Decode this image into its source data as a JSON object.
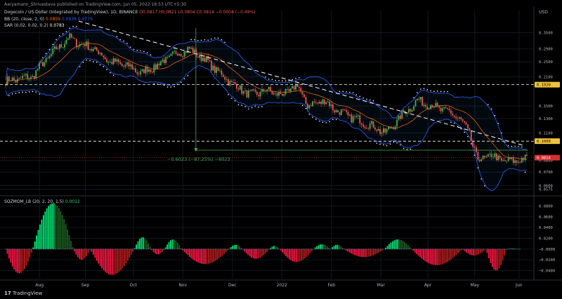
{
  "header": {
    "publisher": "Aaryamann_Shrivastava published on TradingView.com, Jun 05, 2022 18:53 UTC+5:30",
    "symbol": "Dogecoin / US Dollar (Integrated by TradingView), 1D, BINANCE",
    "ohlc": {
      "o": "O0.0817",
      "h": "H0.0821",
      "l": "L0.0804",
      "c": "C0.0814",
      "change": "−0.0004 (−0.49%)"
    },
    "currency": "USD"
  },
  "indicators": {
    "bb": {
      "label": "BB (20, close, 2, 0)",
      "v1": "0.0859",
      "v2": "0.0939",
      "v3": "0.0779"
    },
    "sar": {
      "label": "SAR (0.02, 0.02, 0.2)",
      "v1": "0.0783"
    },
    "sqz": {
      "label": "SQZMOM_LB (20, 2, 20, 1.5)",
      "v1": "0.0012"
    }
  },
  "measure_label": "−0.6023 (−87.25%) −6023",
  "logo": "TradingView",
  "colors": {
    "up": "#26a69a",
    "up_candle": "#4caf50",
    "down": "#ef5350",
    "bb_band": "#2962ff",
    "bb_basis": "#ff6d00",
    "sar": "#ffffff",
    "mom_up_strong": "#00e676",
    "mom_up_weak": "#1b5e20",
    "mom_down_strong": "#ff1744",
    "mom_down_weak": "#b71c1c",
    "measure": "#4caf50",
    "price_tag": "#d32f2f",
    "yellow_tag": "#f0c23a"
  },
  "chart_data": [
    {
      "type": "line",
      "title": "Dogecoin / US Dollar",
      "subtitle": "1D, BINANCE",
      "y_scale": "log",
      "x_ticks": [
        "Aug",
        "Sep",
        "Oct",
        "Nov",
        "Dec",
        "2022",
        "Feb",
        "Mar",
        "Apr",
        "May",
        "Jun"
      ],
      "y_ticks": [
        "0.3500",
        "0.2900",
        "0.2500",
        "0.2100",
        "0.1500",
        "0.1300",
        "0.1100",
        "0.0800",
        "0.0700",
        "0.0600",
        "0.0575"
      ],
      "y_tick_values": [
        0.35,
        0.29,
        0.25,
        0.21,
        0.15,
        0.13,
        0.11,
        0.08,
        0.07,
        0.06,
        0.0575
      ],
      "ylim": [
        0.055,
        0.42
      ],
      "price_lines": [
        {
          "label": "0.1920",
          "value": 0.192,
          "style": "dashed"
        },
        {
          "label": "0.1000",
          "value": 0.1,
          "style": "dashed"
        }
      ],
      "last_price": {
        "label": "0.0814",
        "value": 0.0814
      },
      "close_series": {
        "months": [
          "Aug",
          "Sep",
          "Oct",
          "Nov",
          "Dec",
          "2022",
          "Feb",
          "Mar",
          "Apr",
          "May",
          "Jun"
        ],
        "values": [
          0.28,
          0.26,
          0.22,
          0.27,
          0.22,
          0.17,
          0.15,
          0.12,
          0.14,
          0.08,
          0.0814
        ]
      },
      "key_points": [
        {
          "x": 0.0,
          "y": 0.2
        },
        {
          "x": 0.05,
          "y": 0.21
        },
        {
          "x": 0.08,
          "y": 0.26
        },
        {
          "x": 0.12,
          "y": 0.33
        },
        {
          "x": 0.14,
          "y": 0.31
        },
        {
          "x": 0.17,
          "y": 0.29
        },
        {
          "x": 0.2,
          "y": 0.25
        },
        {
          "x": 0.23,
          "y": 0.24
        },
        {
          "x": 0.26,
          "y": 0.22
        },
        {
          "x": 0.29,
          "y": 0.24
        },
        {
          "x": 0.32,
          "y": 0.27
        },
        {
          "x": 0.35,
          "y": 0.29
        },
        {
          "x": 0.38,
          "y": 0.26
        },
        {
          "x": 0.41,
          "y": 0.22
        },
        {
          "x": 0.44,
          "y": 0.19
        },
        {
          "x": 0.47,
          "y": 0.17
        },
        {
          "x": 0.5,
          "y": 0.18
        },
        {
          "x": 0.53,
          "y": 0.17
        },
        {
          "x": 0.56,
          "y": 0.19
        },
        {
          "x": 0.58,
          "y": 0.15
        },
        {
          "x": 0.61,
          "y": 0.16
        },
        {
          "x": 0.64,
          "y": 0.14
        },
        {
          "x": 0.67,
          "y": 0.13
        },
        {
          "x": 0.7,
          "y": 0.12
        },
        {
          "x": 0.73,
          "y": 0.11
        },
        {
          "x": 0.76,
          "y": 0.135
        },
        {
          "x": 0.79,
          "y": 0.16
        },
        {
          "x": 0.82,
          "y": 0.15
        },
        {
          "x": 0.85,
          "y": 0.14
        },
        {
          "x": 0.87,
          "y": 0.13
        },
        {
          "x": 0.89,
          "y": 0.11
        },
        {
          "x": 0.905,
          "y": 0.08
        },
        {
          "x": 0.93,
          "y": 0.085
        },
        {
          "x": 0.96,
          "y": 0.079
        },
        {
          "x": 1.0,
          "y": 0.0814
        }
      ]
    },
    {
      "type": "bar",
      "title": "SQZMOM_LB (20, 2, 20, 1.5)",
      "y_ticks": [
        "0.0800",
        "0.0600",
        "0.0400",
        "0.0200",
        "−0.0000",
        "−0.0200",
        "−0.0400"
      ],
      "y_tick_values": [
        0.08,
        0.06,
        0.04,
        0.02,
        0,
        -0.02,
        -0.04
      ],
      "ylim": [
        -0.055,
        0.095
      ],
      "segments": [
        {
          "from": 0.0,
          "to": 0.08,
          "peak": -0.045
        },
        {
          "from": 0.08,
          "to": 0.2,
          "peak": 0.085
        },
        {
          "from": 0.2,
          "to": 0.25,
          "peak": -0.02
        },
        {
          "from": 0.25,
          "to": 0.38,
          "peak": -0.048
        },
        {
          "from": 0.38,
          "to": 0.43,
          "peak": 0.022
        },
        {
          "from": 0.43,
          "to": 0.47,
          "peak": -0.01
        },
        {
          "from": 0.47,
          "to": 0.52,
          "peak": 0.018
        },
        {
          "from": 0.52,
          "to": 0.66,
          "peak": -0.028
        },
        {
          "from": 0.66,
          "to": 0.7,
          "peak": 0.008
        },
        {
          "from": 0.7,
          "to": 0.78,
          "peak": -0.018
        },
        {
          "from": 0.78,
          "to": 0.81,
          "peak": 0.006
        },
        {
          "from": 0.81,
          "to": 0.91,
          "peak": -0.024
        },
        {
          "from": 0.91,
          "to": 0.96,
          "peak": 0.009
        },
        {
          "from": 0.96,
          "to": 1.0,
          "peak": 0.008
        },
        {
          "from": 1.0,
          "to": 1.12,
          "peak": -0.015
        },
        {
          "from": 1.12,
          "to": 1.2,
          "peak": 0.018
        },
        {
          "from": 1.2,
          "to": 1.35,
          "peak": -0.03
        },
        {
          "from": 1.35,
          "to": 1.42,
          "peak": -0.012
        },
        {
          "from": 1.42,
          "to": 1.48,
          "peak": -0.04
        },
        {
          "from": 1.48,
          "to": 1.52,
          "peak": 0.001
        }
      ]
    }
  ]
}
